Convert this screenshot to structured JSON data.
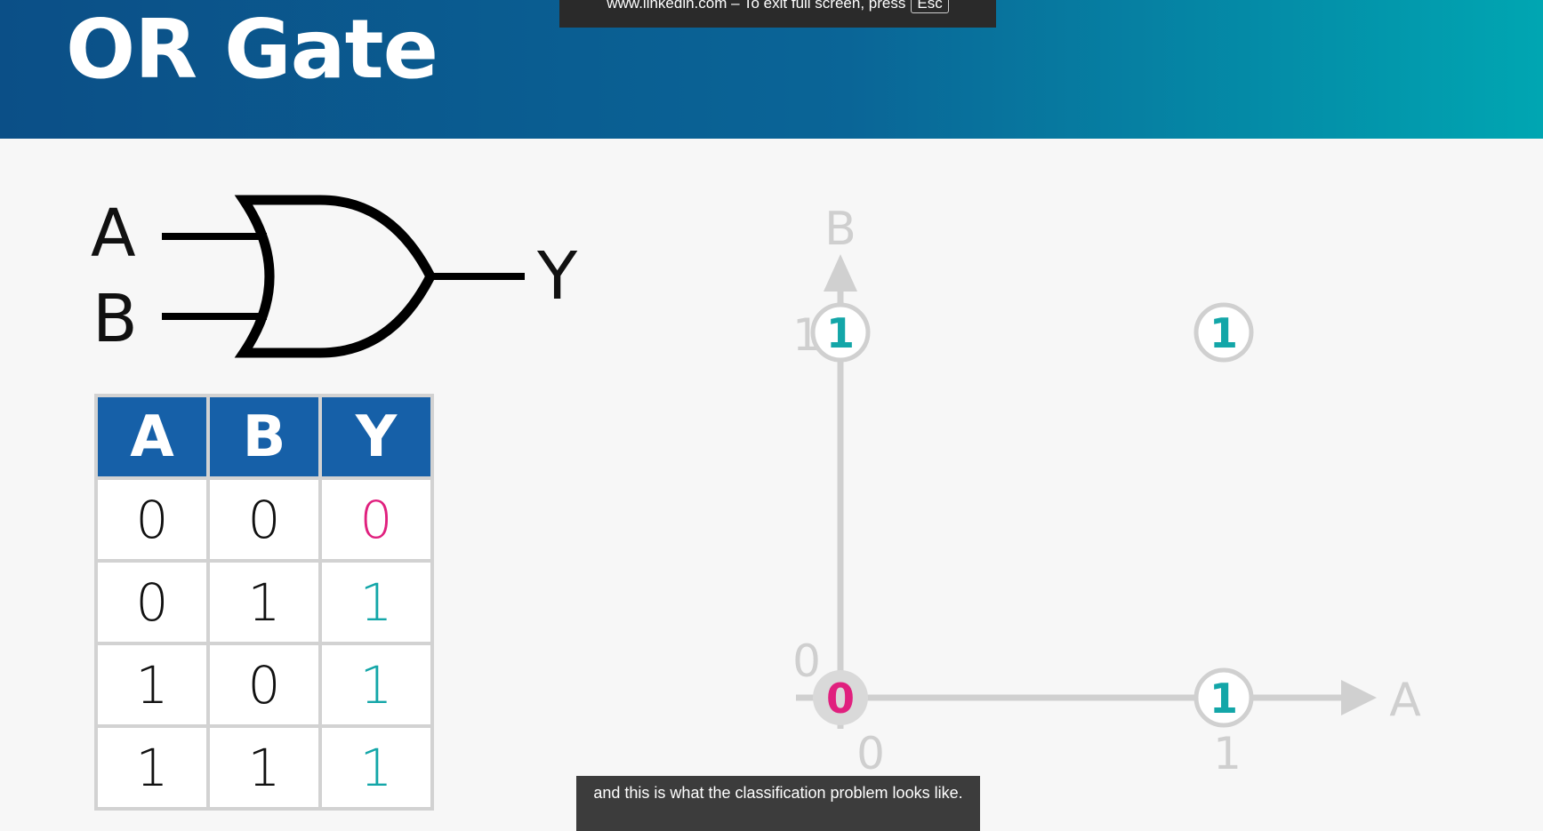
{
  "slide": {
    "title": "OR Gate"
  },
  "fullscreen_notice": {
    "text": "www.linkedin.com – To exit full screen, press",
    "key": "Esc"
  },
  "gate": {
    "input_a": "A",
    "input_b": "B",
    "output": "Y"
  },
  "truth_table": {
    "headers": [
      "A",
      "B",
      "Y"
    ],
    "rows": [
      [
        "0",
        "0",
        "0"
      ],
      [
        "0",
        "1",
        "1"
      ],
      [
        "1",
        "0",
        "1"
      ],
      [
        "1",
        "1",
        "1"
      ]
    ]
  },
  "chart_data": {
    "type": "scatter",
    "xlabel": "A",
    "ylabel": "B",
    "x_ticks": [
      "0",
      "1"
    ],
    "y_ticks": [
      "0",
      "1"
    ],
    "xlim": [
      0,
      1
    ],
    "ylim": [
      0,
      1
    ],
    "points": [
      {
        "x": 0,
        "y": 0,
        "label": "0"
      },
      {
        "x": 0,
        "y": 1,
        "label": "1"
      },
      {
        "x": 1,
        "y": 0,
        "label": "1"
      },
      {
        "x": 1,
        "y": 1,
        "label": "1"
      }
    ]
  },
  "colors": {
    "zero": "#e0207e",
    "one": "#13a6a8",
    "axis": "#d0d0d0",
    "header_blue": "#1660a8"
  },
  "caption": {
    "text": "and this is what the classification problem looks like."
  }
}
